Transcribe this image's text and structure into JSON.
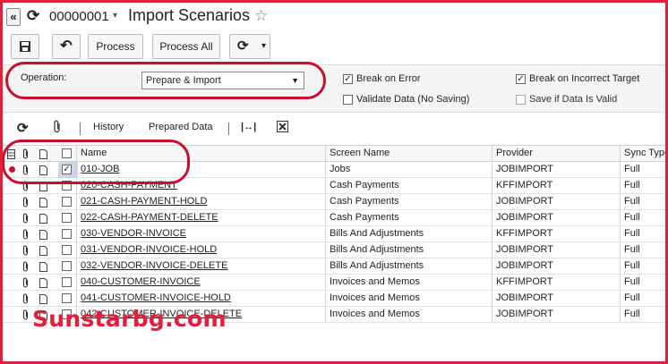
{
  "header": {
    "collapse_glyph": "«",
    "refresh_glyph": "⟳",
    "screen_id": "00000001",
    "screen_id_caret": "▾",
    "title": "Import Scenarios",
    "favorite_glyph": "☆"
  },
  "toolbar": {
    "save_glyph": "💾",
    "undo_glyph": "↶",
    "process_label": "Process",
    "process_all_label": "Process All",
    "schedule_glyph": "⟳",
    "schedule_caret": "▾"
  },
  "params": {
    "operation_label": "Operation:",
    "operation_value": "Prepare & Import",
    "operation_caret": "▼",
    "break_on_error": {
      "label": "Break on Error",
      "checked": true
    },
    "break_on_incorrect_target": {
      "label": "Break on Incorrect Target",
      "checked": true
    },
    "validate_data": {
      "label": "Validate Data (No Saving)",
      "checked": false
    },
    "save_if_valid": {
      "label": "Save if Data Is Valid",
      "checked": false
    }
  },
  "grid_toolbar": {
    "refresh_glyph": "⟳",
    "attach_glyph": "📎",
    "history_label": "History",
    "prepared_data_label": "Prepared Data",
    "fit_columns_glyph": "|↔|",
    "export_excel_glyph": "⊠"
  },
  "grid": {
    "columns": [
      "Name",
      "Screen Name",
      "Provider",
      "Sync Type"
    ],
    "header_icons": [
      "grid-icon",
      "paperclip-icon",
      "note-icon",
      "checkbox"
    ],
    "rows": [
      {
        "name": "010-JOB",
        "screen": "Jobs",
        "provider": "JOBIMPORT",
        "sync": "Full",
        "checked": true,
        "current": true
      },
      {
        "name": "020-CASH-PAYMENT",
        "screen": "Cash Payments",
        "provider": "KFFIMPORT",
        "sync": "Full",
        "checked": false
      },
      {
        "name": "021-CASH-PAYMENT-HOLD",
        "screen": "Cash Payments",
        "provider": "JOBIMPORT",
        "sync": "Full",
        "checked": false
      },
      {
        "name": "022-CASH-PAYMENT-DELETE",
        "screen": "Cash Payments",
        "provider": "JOBIMPORT",
        "sync": "Full",
        "checked": false
      },
      {
        "name": "030-VENDOR-INVOICE",
        "screen": "Bills And Adjustments",
        "provider": "KFFIMPORT",
        "sync": "Full",
        "checked": false
      },
      {
        "name": "031-VENDOR-INVOICE-HOLD",
        "screen": "Bills And Adjustments",
        "provider": "JOBIMPORT",
        "sync": "Full",
        "checked": false
      },
      {
        "name": "032-VENDOR-INVOICE-DELETE",
        "screen": "Bills And Adjustments",
        "provider": "JOBIMPORT",
        "sync": "Full",
        "checked": false
      },
      {
        "name": "040-CUSTOMER-INVOICE",
        "screen": "Invoices and Memos",
        "provider": "KFFIMPORT",
        "sync": "Full",
        "checked": false
      },
      {
        "name": "041-CUSTOMER-INVOICE-HOLD",
        "screen": "Invoices and Memos",
        "provider": "JOBIMPORT",
        "sync": "Full",
        "checked": false
      },
      {
        "name": "042-CUSTOMER-INVOICE-DELETE",
        "screen": "Invoices and Memos",
        "provider": "JOBIMPORT",
        "sync": "Full",
        "checked": false
      }
    ]
  },
  "watermark": "Sunstarbg.com",
  "colors": {
    "annotation_red": "#c8102e",
    "selection_blue": "#c9d7e8"
  }
}
